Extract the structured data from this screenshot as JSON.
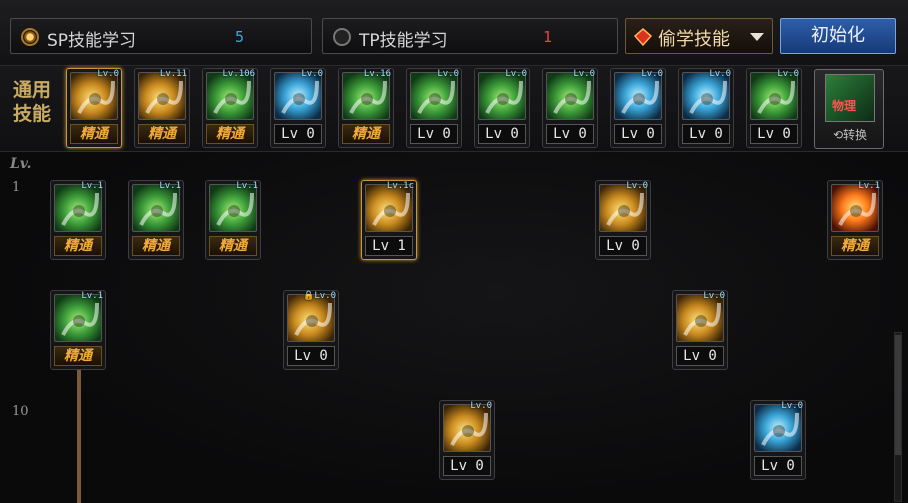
{
  "tabs": {
    "sp": {
      "label": "SP技能学习",
      "count": "5",
      "count_color": "#3ba7e0"
    },
    "tp": {
      "label": "TP技能学习",
      "count": "1",
      "count_color": "#e24a3a"
    }
  },
  "steal_dropdown": {
    "label": "偷学技能"
  },
  "reset_button": {
    "label": "初始化"
  },
  "common": {
    "label": "通用技能",
    "switch_label": "⟲转换",
    "switch_icon_text": "物理",
    "skills": [
      {
        "name": "common-skill-1",
        "icon_color": "gold",
        "tag": "Lv.0",
        "badge": "精通",
        "type": "master",
        "selected": true
      },
      {
        "name": "common-skill-2",
        "icon_color": "gold",
        "tag": "Lv.11",
        "badge": "精通",
        "type": "master"
      },
      {
        "name": "common-skill-3",
        "icon_color": "green",
        "tag": "Lv.106",
        "badge": "精通",
        "type": "master"
      },
      {
        "name": "common-skill-4",
        "icon_color": "blue",
        "tag": "Lv.0",
        "badge": "Lv 0",
        "type": "lv"
      },
      {
        "name": "common-skill-5",
        "icon_color": "green",
        "tag": "Lv.16",
        "badge": "精通",
        "type": "master"
      },
      {
        "name": "common-skill-6",
        "icon_color": "green",
        "tag": "Lv.0",
        "badge": "Lv 0",
        "type": "lv"
      },
      {
        "name": "common-skill-7",
        "icon_color": "green",
        "tag": "Lv.0",
        "badge": "Lv 0",
        "type": "lv"
      },
      {
        "name": "common-skill-8",
        "icon_color": "green",
        "tag": "Lv.0",
        "badge": "Lv 0",
        "type": "lv"
      },
      {
        "name": "common-skill-9",
        "icon_color": "blue",
        "tag": "Lv.0",
        "badge": "Lv 0",
        "type": "lv"
      },
      {
        "name": "common-skill-10",
        "icon_color": "blue",
        "tag": "Lv.0",
        "badge": "Lv 0",
        "type": "lv"
      },
      {
        "name": "common-skill-11",
        "icon_color": "green",
        "tag": "Lv.0",
        "badge": "Lv 0",
        "type": "lv"
      }
    ]
  },
  "tree": {
    "level_header": "Lv.",
    "row_labels": [
      "1",
      "10"
    ],
    "skills": [
      {
        "name": "tree-skill-r1-1",
        "icon_color": "green",
        "tag": "Lv.1",
        "badge": "精通",
        "type": "master"
      },
      {
        "name": "tree-skill-r1-2",
        "icon_color": "green",
        "tag": "Lv.1",
        "badge": "精通",
        "type": "master"
      },
      {
        "name": "tree-skill-r1-3",
        "icon_color": "green",
        "tag": "Lv.1",
        "badge": "精通",
        "type": "master"
      },
      {
        "name": "tree-skill-r1-4",
        "icon_color": "gold",
        "tag": "Lv.1c",
        "badge": "Lv 1",
        "type": "lv",
        "selected": true
      },
      {
        "name": "tree-skill-r1-5",
        "icon_color": "gold",
        "tag": "Lv.0",
        "badge": "Lv 0",
        "type": "lv"
      },
      {
        "name": "tree-skill-r1-6",
        "icon_color": "fire",
        "tag": "Lv.1",
        "badge": "精通",
        "type": "master"
      },
      {
        "name": "tree-skill-r2-1",
        "icon_color": "green",
        "tag": "Lv.1",
        "badge": "精通",
        "type": "master"
      },
      {
        "name": "tree-skill-r2-2",
        "icon_color": "gold",
        "tag": "Lv.0",
        "badge": "Lv 0",
        "type": "lv",
        "locked": true
      },
      {
        "name": "tree-skill-r2-3",
        "icon_color": "gold",
        "tag": "Lv.0",
        "badge": "Lv 0",
        "type": "lv"
      },
      {
        "name": "tree-skill-r3-1",
        "icon_color": "gold",
        "tag": "Lv.0",
        "badge": "Lv 0",
        "type": "lv"
      },
      {
        "name": "tree-skill-r3-2",
        "icon_color": "blue",
        "tag": "Lv.0",
        "badge": "Lv 0",
        "type": "lv"
      }
    ]
  }
}
